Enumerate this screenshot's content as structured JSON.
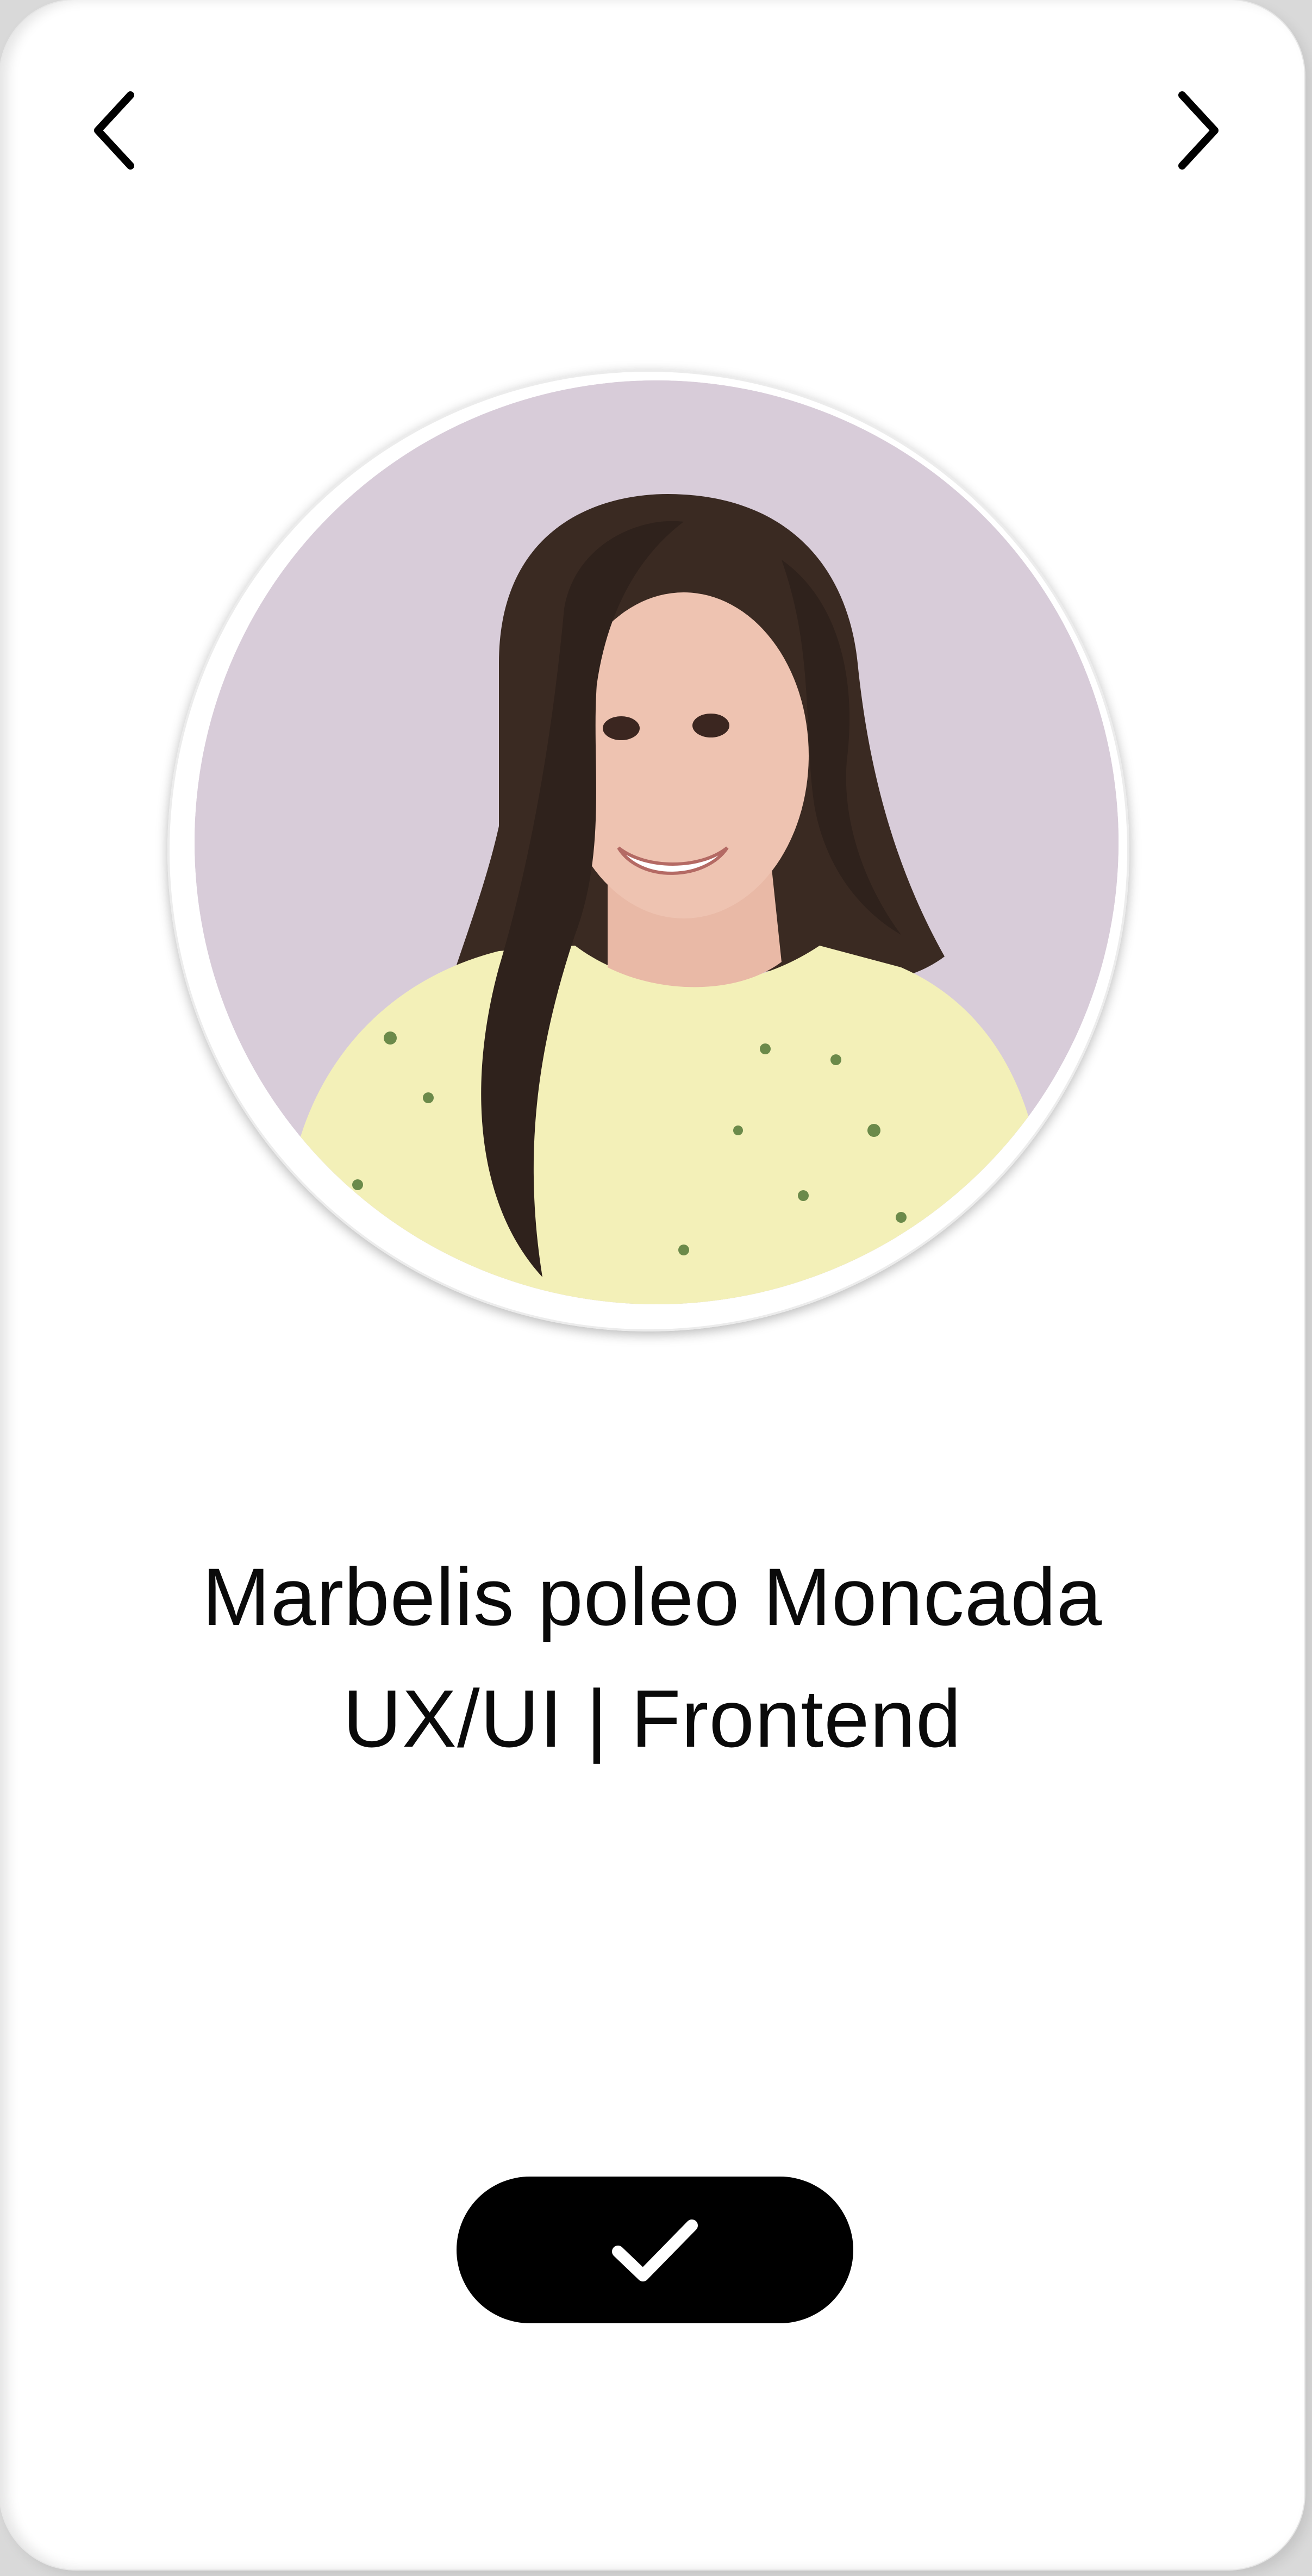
{
  "profile": {
    "name": "Marbelis poleo Moncada",
    "role": "UX/UI | Frontend",
    "photo_description_icon": "profile-photo"
  },
  "navigation": {
    "prev_icon": "chevron-left-icon",
    "next_icon": "chevron-right-icon"
  },
  "actions": {
    "confirm_icon": "check-icon"
  },
  "colors": {
    "card_background": "#ffffff",
    "photo_background": "#d8ccd9",
    "button_background": "#000000",
    "text": "#0a0a0a"
  }
}
